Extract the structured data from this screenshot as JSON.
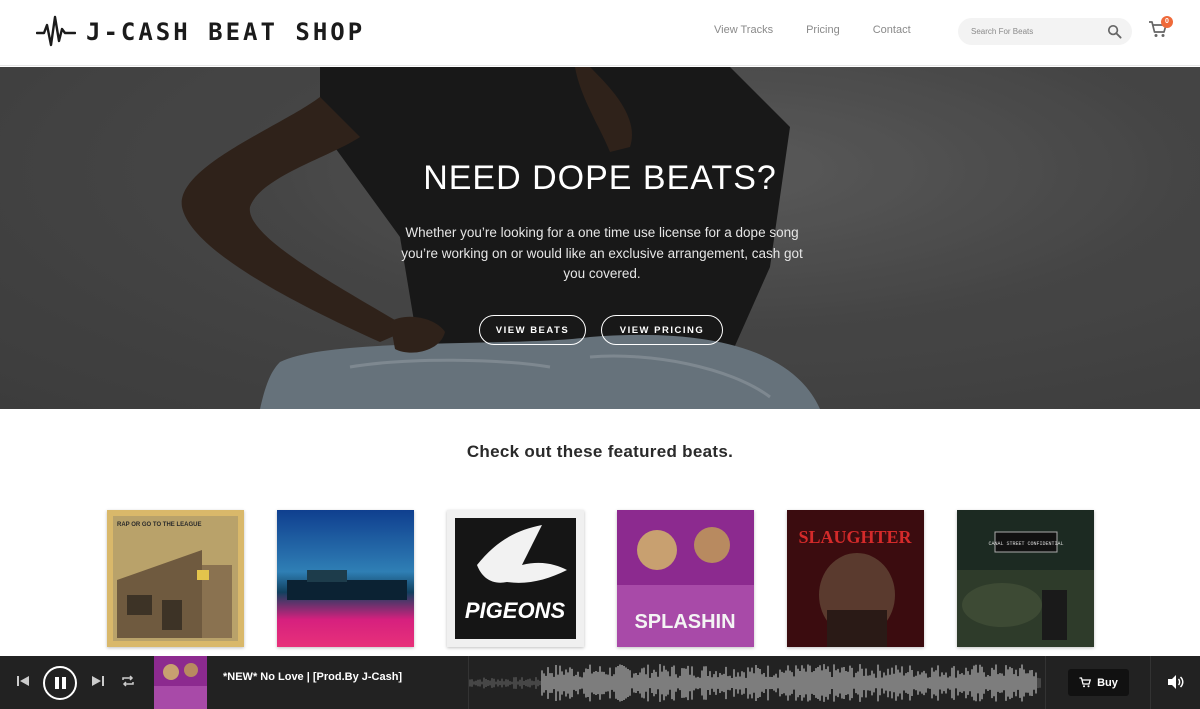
{
  "header": {
    "brand": "J-CASH BEAT SHOP",
    "nav": [
      "View Tracks",
      "Pricing",
      "Contact"
    ],
    "search_placeholder": "Search For Beats",
    "cart_count": "0"
  },
  "hero": {
    "title": "NEED DOPE BEATS?",
    "subtitle": "Whether you’re looking for a one time use license for a dope song you’re working on or would like an exclusive arrangement, cash got you covered.",
    "btn_beats": "VIEW BEATS",
    "btn_pricing": "VIEW PRICING"
  },
  "featured": {
    "title": "Check out these featured beats.",
    "covers": [
      {
        "name": "cover-league",
        "text": "RAP OR GO TO THE LEAGUE",
        "color": "#d9b86a"
      },
      {
        "name": "cover-neon",
        "text": "",
        "color": "#1d3c7a"
      },
      {
        "name": "cover-pigeons",
        "text": "PIGEONS",
        "color": "#101010"
      },
      {
        "name": "cover-splashin",
        "text": "SPLASHIN",
        "color": "#8c2a8f"
      },
      {
        "name": "cover-slaughter",
        "text": "SLAUGHTER",
        "color": "#3b0c0f"
      },
      {
        "name": "cover-canal",
        "text": "CANAL STREET CONFIDENTIAL",
        "color": "#1c2a22"
      }
    ]
  },
  "player": {
    "track_title": "*NEW* No Love | [Prod.By J-Cash]",
    "buy_label": "Buy"
  },
  "colors": {
    "accent_badge": "#ef6a3a",
    "player_bg": "#222222"
  }
}
